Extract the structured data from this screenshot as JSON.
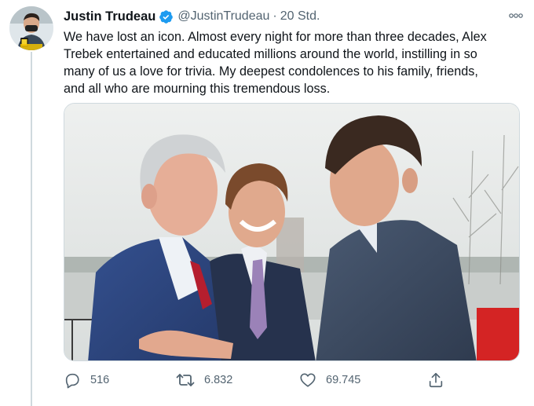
{
  "author": {
    "name": "Justin Trudeau",
    "handle": "@JustinTrudeau",
    "separator": "·",
    "time": "20 Std.",
    "verified": true
  },
  "tweet": {
    "lines": [
      "We have lost an icon. Almost every night for more than three decades, Alex",
      "Trebek entertained and educated millions around the world, instilling in so",
      "many of us a love for trivia. My deepest condolences to his family, friends,",
      "and all who are mourning this tremendous loss."
    ]
  },
  "actions": {
    "replies": "516",
    "retweets": "6.832",
    "likes": "69.745"
  },
  "colors": {
    "verified_blue": "#1d9bf0",
    "secondary_text": "#536471",
    "suit_blue": "#2d3f6e"
  },
  "icons": [
    "verified-badge-icon",
    "more-options-icon",
    "reply-icon",
    "retweet-icon",
    "like-icon",
    "share-icon"
  ]
}
